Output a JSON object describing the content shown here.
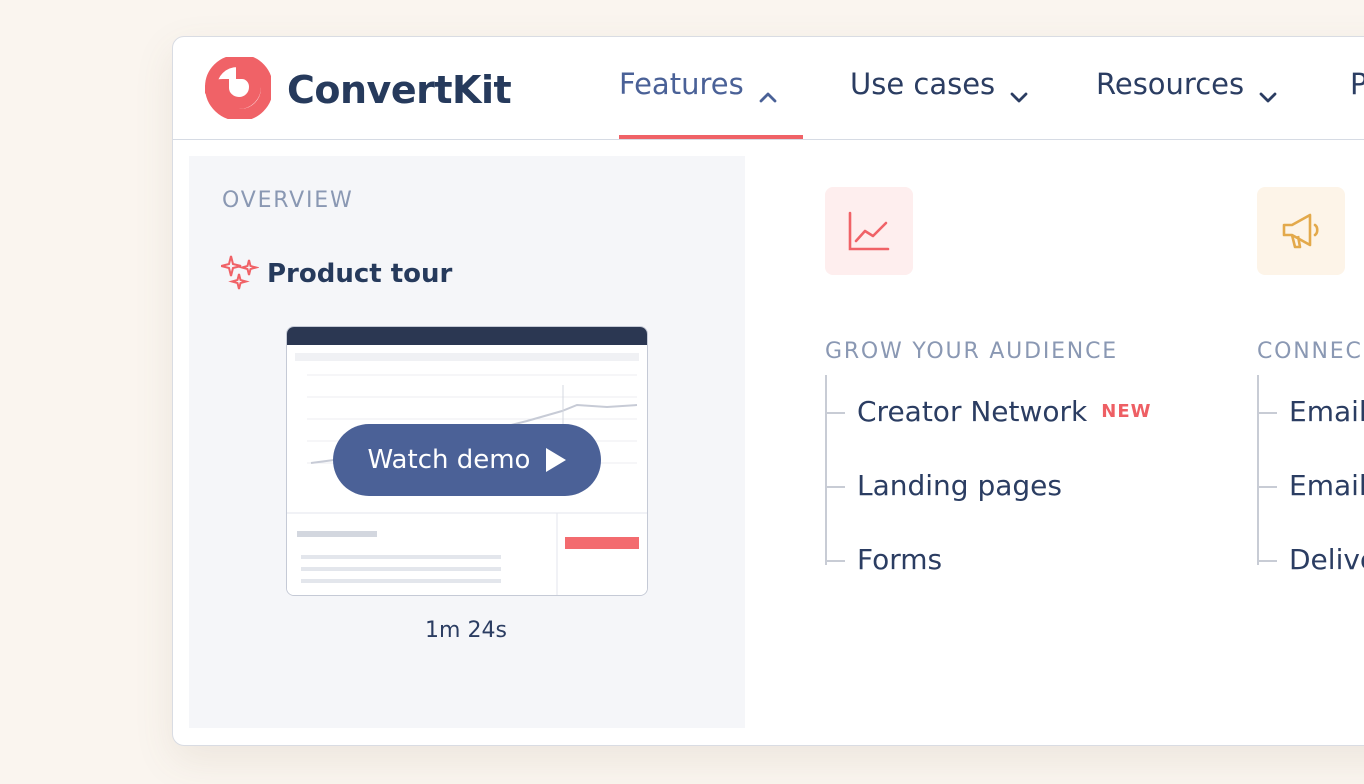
{
  "brand": {
    "name": "ConvertKit",
    "accent": "#f06267"
  },
  "nav": {
    "items": [
      {
        "label": "Features",
        "active": true
      },
      {
        "label": "Use cases"
      },
      {
        "label": "Resources"
      },
      {
        "label": "P"
      }
    ]
  },
  "overview": {
    "section_label": "OVERVIEW",
    "tour_label": "Product tour",
    "watch_label": "Watch demo",
    "duration": "1m 24s"
  },
  "columns": [
    {
      "title": "GROW YOUR AUDIENCE",
      "icon": "chart-line-icon",
      "items": [
        {
          "label": "Creator Network",
          "badge": "NEW"
        },
        {
          "label": "Landing pages"
        },
        {
          "label": "Forms"
        }
      ]
    },
    {
      "title": "CONNEC",
      "icon": "megaphone-icon",
      "items": [
        {
          "label": "Email"
        },
        {
          "label": "Email"
        },
        {
          "label": "Delive"
        }
      ]
    }
  ]
}
